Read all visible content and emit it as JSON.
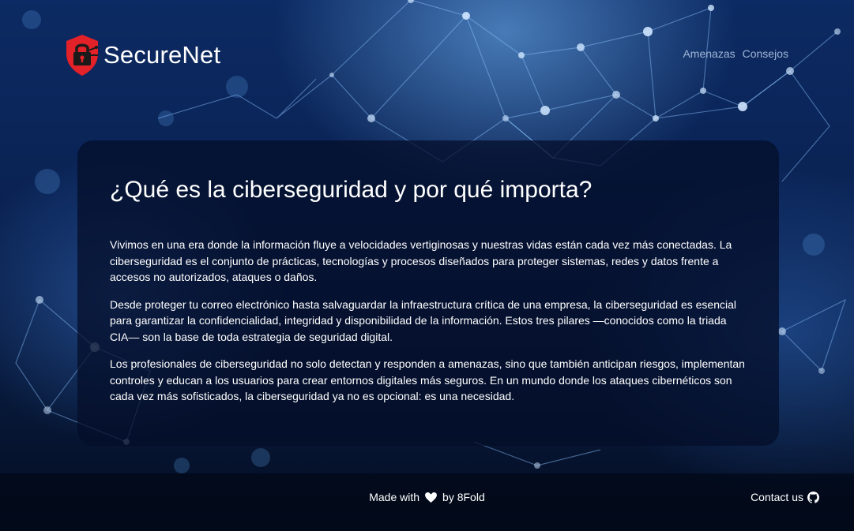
{
  "brand": {
    "name": "SecureNet",
    "logo_icon": "shield-lock-icon",
    "logo_color": "#e32128"
  },
  "nav": {
    "items": [
      {
        "label": "Amenazas"
      },
      {
        "label": "Consejos"
      }
    ]
  },
  "main": {
    "title": "¿Qué es la ciberseguridad y por qué importa?",
    "paragraphs": [
      "Vivimos en una era donde la información fluye a velocidades vertiginosas y nuestras vidas están cada vez más conectadas. La ciberseguridad es el conjunto de prácticas, tecnologías y procesos diseñados para proteger sistemas, redes y datos frente a accesos no autorizados, ataques o daños.",
      "Desde proteger tu correo electrónico hasta salvaguardar la infraestructura crítica de una empresa, la ciberseguridad es esencial para garantizar la confidencialidad, integridad y disponibilidad de la información. Estos tres pilares —conocidos como la triada CIA— son la base de toda estrategia de seguridad digital.",
      "Los profesionales de ciberseguridad no solo detectan y responden a amenazas, sino que también anticipan riesgos, implementan controles y educan a los usuarios para crear entornos digitales más seguros. En un mundo donde los ataques cibernéticos son cada vez más sofisticados, la ciberseguridad ya no es opcional: es una necesidad."
    ]
  },
  "footer": {
    "made_prefix": "Made with",
    "heart_icon": "heart-icon",
    "made_suffix": "by 8Fold",
    "contact_label": "Contact us",
    "contact_icon": "github-icon"
  },
  "colors": {
    "background_top": "#0c2a63",
    "background_bottom": "#040d22",
    "nav_link": "#9fb6d6",
    "text": "#ffffff"
  }
}
